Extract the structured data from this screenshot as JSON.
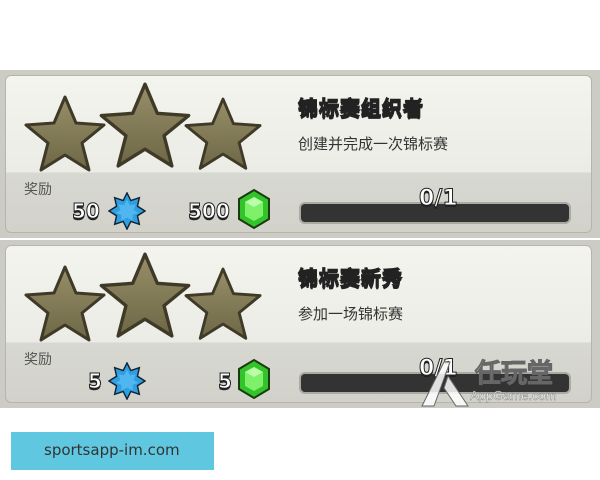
{
  "achievements": [
    {
      "title": "锦标赛组织者",
      "description": "创建并完成一次锦标赛",
      "reward_label": "奖励",
      "xp_reward": "50",
      "gem_reward": "500",
      "progress_text": "0/1",
      "progress": 0,
      "stars_earned": 0,
      "stars_total": 3
    },
    {
      "title": "锦标赛新秀",
      "description": "参加一场锦标赛",
      "reward_label": "奖励",
      "xp_reward": "5",
      "gem_reward": "5",
      "progress_text": "0/1",
      "progress": 0,
      "stars_earned": 0,
      "stars_total": 3
    }
  ],
  "watermark": {
    "brand": "任玩堂",
    "url": "AppGame.com"
  },
  "footer_url": "sportsapp-im.com",
  "icons": {
    "xp": "xp-star-icon",
    "gem": "gem-icon",
    "star": "star-icon"
  },
  "colors": {
    "star_fill": "#857d58",
    "xp": "#2f9fe0",
    "gem": "#33c42b",
    "bar": "#333333"
  }
}
